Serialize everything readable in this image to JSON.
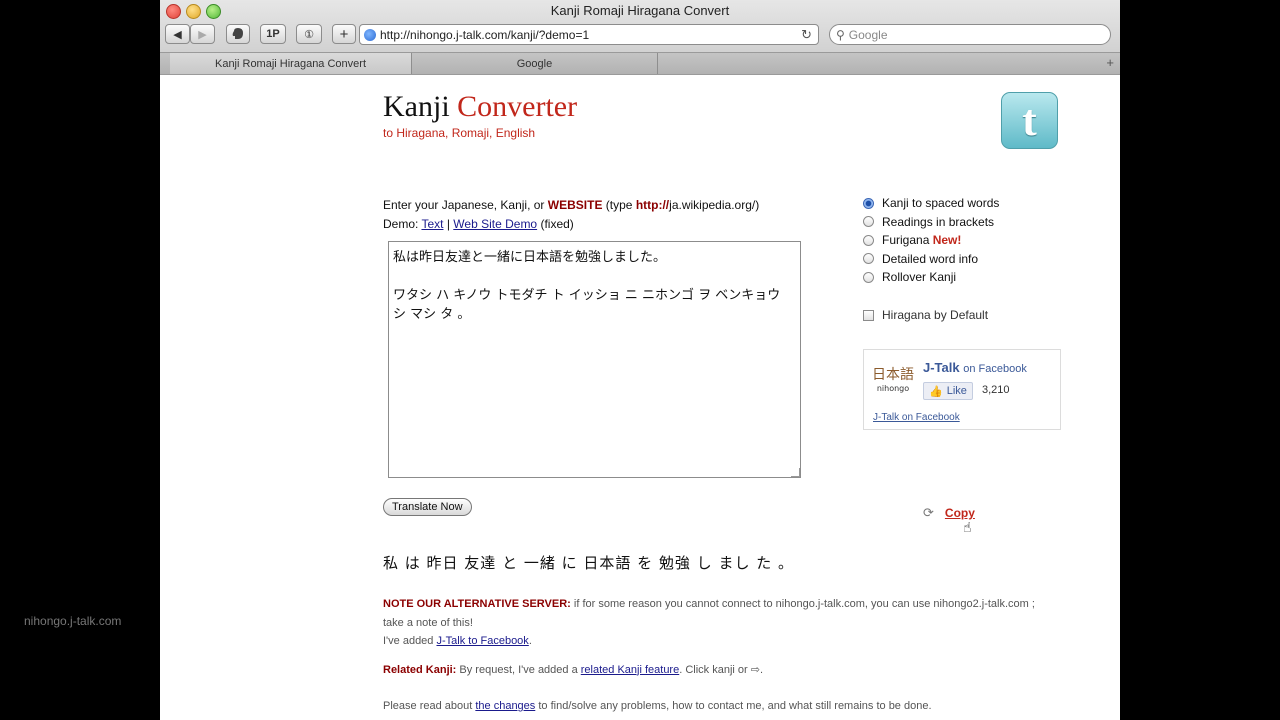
{
  "window": {
    "title": "Kanji Romaji Hiragana Convert"
  },
  "toolbar": {
    "back_icon": "◀",
    "forward_icon": "▶",
    "evernote_icon": "elephant-icon",
    "onepassword_label": "1P",
    "info_icon": "①",
    "add_icon": "+",
    "url": "http://nihongo.j-talk.com/kanji/?demo=1",
    "search_placeholder": "Google"
  },
  "tabs": [
    {
      "label": "Kanji Romaji Hiragana Convert"
    },
    {
      "label": "Google"
    }
  ],
  "page": {
    "logo_main": "Kanji",
    "logo_accent": "Converter",
    "logo_sub": "to Hiragana, Romaji, English",
    "intro_prefix": "Enter your Japanese, Kanji, or",
    "intro_website": "WEBSITE",
    "intro_type": "(type",
    "intro_http": "http://",
    "intro_example": "ja.wikipedia.org/)",
    "demo_label": "Demo:",
    "demo_text_link": "Text",
    "demo_sep": "|",
    "demo_web_link": "Web Site Demo",
    "demo_fixed": "(fixed)",
    "textarea_value": "私は昨日友達と一緒に日本語を勉強しました。\n\nワタシ ハ キノウ トモダチ ト イッショ ニ ニホンゴ ヲ ベンキョウ シ マシ タ 。",
    "translate_button": "Translate Now",
    "options": [
      {
        "label": "Kanji to spaced words",
        "selected": true
      },
      {
        "label": "Readings in brackets",
        "selected": false
      },
      {
        "label": "Furigana",
        "badge": "New!",
        "selected": false
      },
      {
        "label": "Detailed word info",
        "selected": false
      },
      {
        "label": "Rollover Kanji",
        "selected": false
      }
    ],
    "hiragana_default": "Hiragana by Default",
    "facebook": {
      "logo_text": "日本語",
      "logo_sub": "nihongo",
      "name": "J-Talk",
      "on": "on Facebook",
      "like": "Like",
      "count": "3,210",
      "link": "J-Talk on Facebook"
    },
    "copy_label": "Copy",
    "result": "私 は 昨日 友達 と 一緒 に 日本語 を 勉強 し まし た 。",
    "notice_label": "NOTE OUR ALTERNATIVE SERVER:",
    "notice_text": " if for some reason you cannot connect to nihongo.j-talk.com, you can use nihongo2.j-talk.com ;",
    "notice_text2": "take a note of this!",
    "fb_added_prefix": "I've added ",
    "fb_added_link": "J-Talk to Facebook",
    "fb_added_suffix": ".",
    "related_label": "Related Kanji:",
    "related_prefix": " By request, I've added a ",
    "related_link": "related Kanji feature",
    "related_suffix": ". Click kanji or ⇨.",
    "changes_prefix": "Please read about ",
    "changes_link": "the changes",
    "changes_suffix": " to find/solve any problems, how to contact me, and what still remains to be done."
  },
  "footer": {
    "site": "nihongo.j-talk.com"
  }
}
